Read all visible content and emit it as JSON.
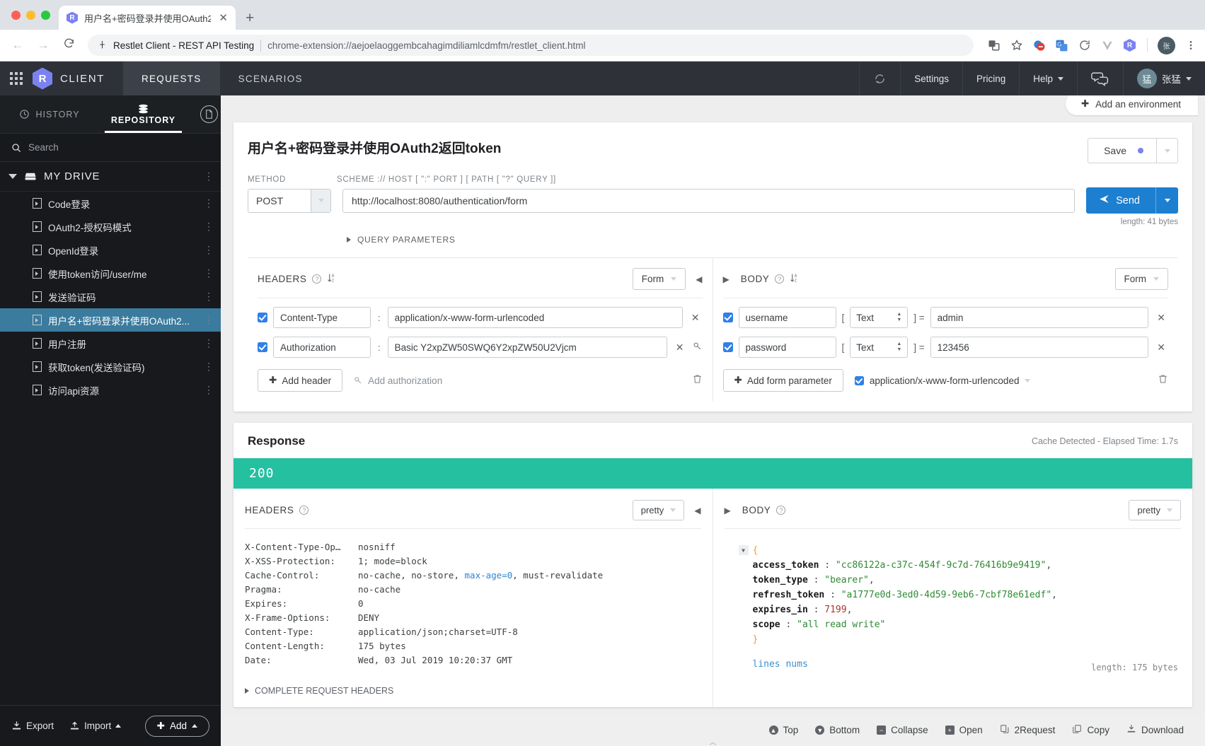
{
  "browser": {
    "tab_title": "用户名+密码登录并使用OAuth2",
    "tab_close": "✕",
    "new_tab": "+",
    "back": "←",
    "forward": "→",
    "reload": "C",
    "omnibox_title": "Restlet Client - REST API Testing",
    "omnibox_url": "chrome-extension://aejoelaoggembcahagimdiliamlcdmfm/restlet_client.html",
    "profile_initial": "张"
  },
  "app_header": {
    "brand_letter": "R",
    "brand_name": "CLIENT",
    "nav": [
      {
        "label": "REQUESTS",
        "active": true
      },
      {
        "label": "SCENARIOS",
        "active": false
      }
    ],
    "settings": "Settings",
    "pricing": "Pricing",
    "help": "Help",
    "user_initial": "猛",
    "user_name": "张猛"
  },
  "sidebar": {
    "tab_history": "HISTORY",
    "tab_repository": "REPOSITORY",
    "search_placeholder": "Search",
    "drive_label": "MY DRIVE",
    "requests": [
      {
        "label": "Code登录",
        "selected": false
      },
      {
        "label": "OAuth2-授权码模式",
        "selected": false
      },
      {
        "label": "OpenId登录",
        "selected": false
      },
      {
        "label": "使用token访问/user/me",
        "selected": false
      },
      {
        "label": "发送验证码",
        "selected": false
      },
      {
        "label": "用户名+密码登录并使用OAuth2...",
        "selected": true
      },
      {
        "label": "用户注册",
        "selected": false
      },
      {
        "label": "获取token(发送验证码)",
        "selected": false
      },
      {
        "label": "访问api资源",
        "selected": false
      }
    ],
    "export": "Export",
    "import": "Import",
    "add": "Add"
  },
  "environment": {
    "add_environment": "Add an environment"
  },
  "request": {
    "title": "用户名+密码登录并使用OAuth2返回token",
    "save_label": "Save",
    "method_label": "METHOD",
    "method_value": "POST",
    "url_label": "SCHEME :// HOST [ \":\" PORT ] [ PATH [ \"?\" QUERY ]]",
    "url_value": "http://localhost:8080/authentication/form",
    "send_label": "Send",
    "length_note": "length: 41 bytes",
    "query_parameters": "QUERY PARAMETERS",
    "headers": {
      "title": "HEADERS",
      "mode": "Form",
      "rows": [
        {
          "checked": true,
          "key": "Content-Type",
          "value": "application/x-www-form-urlencoded",
          "has_key_icon": false
        },
        {
          "checked": true,
          "key": "Authorization",
          "value": "Basic Y2xpZW50SWQ6Y2xpZW50U2Vjcm",
          "has_key_icon": true
        }
      ],
      "add_header": "Add header",
      "add_authorization": "Add authorization"
    },
    "body": {
      "title": "BODY",
      "mode": "Form",
      "rows": [
        {
          "checked": true,
          "key": "username",
          "type": "Text",
          "value": "admin"
        },
        {
          "checked": true,
          "key": "password",
          "type": "Text",
          "value": "123456"
        }
      ],
      "add_form_parameter": "Add form parameter",
      "encoding": "application/x-www-form-urlencoded"
    }
  },
  "response": {
    "title": "Response",
    "meta": "Cache Detected - Elapsed Time: 1.7s",
    "status": "200",
    "headers": {
      "title": "HEADERS",
      "mode": "pretty",
      "rows": [
        {
          "name": "X-Content-Type-Op…",
          "value": "nosniff"
        },
        {
          "name": "X-XSS-Protection:",
          "value": "1; mode=block"
        },
        {
          "name": "Cache-Control:",
          "value": "no-cache, no-store, max-age=0, must-revalidate",
          "highlight": "max-age=0"
        },
        {
          "name": "Pragma:",
          "value": "no-cache"
        },
        {
          "name": "Expires:",
          "value": "0"
        },
        {
          "name": "X-Frame-Options:",
          "value": "DENY"
        },
        {
          "name": "Content-Type:",
          "value": "application/json;charset=UTF-8"
        },
        {
          "name": "Content-Length:",
          "value": "175 bytes"
        },
        {
          "name": "Date:",
          "value": "Wed, 03 Jul 2019 10:20:37 GMT"
        }
      ],
      "complete_request_headers": "COMPLETE REQUEST HEADERS"
    },
    "body": {
      "title": "BODY",
      "mode": "pretty",
      "json": {
        "access_token": "cc86122a-c37c-454f-9c7d-76416b9e9419",
        "token_type": "bearer",
        "refresh_token": "a1777e0d-3ed0-4d59-9eb6-7cbf78e61edf",
        "expires_in": 7199,
        "scope": "all read write"
      },
      "lines_nums": "lines nums",
      "length_note": "length: 175 bytes"
    },
    "footer": [
      {
        "label": "Top",
        "icon": "arrow-up-circle-icon"
      },
      {
        "label": "Bottom",
        "icon": "arrow-down-circle-icon"
      },
      {
        "label": "Collapse",
        "icon": "collapse-icon"
      },
      {
        "label": "Open",
        "icon": "open-icon"
      },
      {
        "label": "2Request",
        "icon": "request-copy-icon"
      },
      {
        "label": "Copy",
        "icon": "copy-icon"
      },
      {
        "label": "Download",
        "icon": "download-icon"
      }
    ]
  },
  "colors": {
    "accent_blue": "#1c7fd0",
    "status_green": "#24c0a0",
    "brand_purple": "#7b82f0",
    "selected_blue": "#3b7b9e"
  }
}
